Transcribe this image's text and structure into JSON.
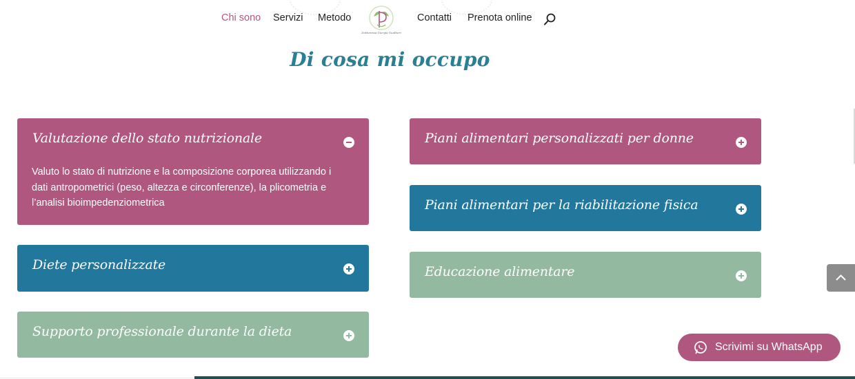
{
  "nav": {
    "items": [
      {
        "label": "Chi sono",
        "active": true
      },
      {
        "label": "Servizi",
        "active": false
      },
      {
        "label": "Metodo",
        "active": false
      },
      {
        "label": "Contatti",
        "active": false
      },
      {
        "label": "Prenota online",
        "active": false
      }
    ],
    "logo_text": "Dottoressa Giorgia Gualtieri",
    "search_icon": "search-icon"
  },
  "section_title": "Di cosa mi occupo",
  "toggles": [
    {
      "title": "Valutazione dello stato nutrizionale",
      "state": "open",
      "color": "#b0577f",
      "body": "Valuto lo stato di nutrizione e la composizione corporea utilizzando i dati antropometrici (peso, altezza e circonferenze), la plicometria e l’analisi bioimpedenziometrica"
    },
    {
      "title": "Piani alimentari personalizzati per donne",
      "state": "closed",
      "color": "#b0577f"
    },
    {
      "title": "Piani alimentari per la riabilitazione fisica",
      "state": "closed",
      "color": "#22779d"
    },
    {
      "title": "Diete personalizzate",
      "state": "closed",
      "color": "#22779d"
    },
    {
      "title": "Educazione alimentare",
      "state": "closed",
      "color": "#93b9a1"
    },
    {
      "title": "Supporto professionale durante la dieta",
      "state": "closed",
      "color": "#93b9a1"
    }
  ],
  "whatsapp": {
    "label": "Scrivimi su WhatsApp",
    "icon": "whatsapp-icon"
  },
  "scroll_top": {
    "icon": "chevron-up-icon"
  },
  "colors": {
    "accent_magenta": "#b0577f",
    "accent_blue": "#22779d",
    "accent_green": "#93b9a1",
    "title_teal": "#2a7f93"
  }
}
